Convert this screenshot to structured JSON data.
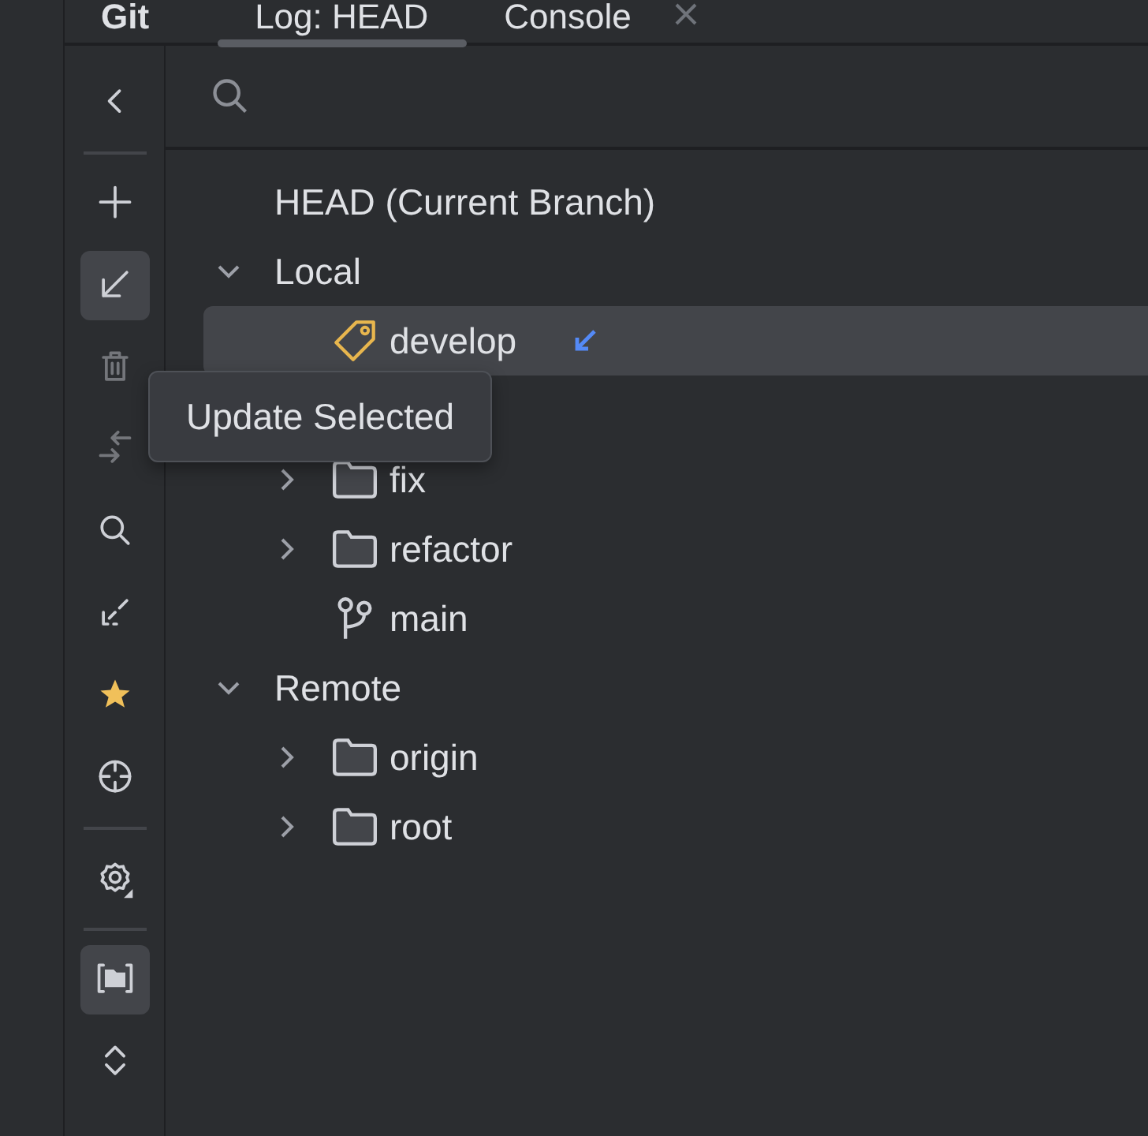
{
  "tool_window": {
    "title": "Git"
  },
  "tabs": [
    {
      "label": "Log: HEAD",
      "selected": true,
      "closable": false
    },
    {
      "label": "Console",
      "selected": false,
      "closable": true
    }
  ],
  "toolbar": [
    {
      "kind": "back",
      "selected": false,
      "disabled": false
    },
    {
      "kind": "separator"
    },
    {
      "kind": "add",
      "selected": false,
      "disabled": false
    },
    {
      "kind": "update",
      "selected": true,
      "disabled": false
    },
    {
      "kind": "delete",
      "selected": false,
      "disabled": true
    },
    {
      "kind": "compare",
      "selected": false,
      "disabled": true
    },
    {
      "kind": "search",
      "selected": false,
      "disabled": false
    },
    {
      "kind": "fetch",
      "selected": false,
      "disabled": false
    },
    {
      "kind": "favorite",
      "selected": false,
      "disabled": false
    },
    {
      "kind": "locate",
      "selected": false,
      "disabled": false
    },
    {
      "kind": "separator"
    },
    {
      "kind": "settings",
      "selected": false,
      "disabled": false
    },
    {
      "kind": "separator"
    },
    {
      "kind": "group",
      "selected": true,
      "disabled": false
    },
    {
      "kind": "expand",
      "selected": false,
      "disabled": false
    }
  ],
  "tree": [
    {
      "label": "HEAD (Current Branch)",
      "selected": false
    },
    {
      "label": "Local",
      "expanded": true,
      "selected": false,
      "children": [
        {
          "label": "develop",
          "kind": "tag",
          "selected": true,
          "incoming": true
        },
        {
          "label": "fix",
          "kind": "folder",
          "expanded": false,
          "selected": false,
          "incoming": false
        },
        {
          "label": "refactor",
          "kind": "folder",
          "expanded": false,
          "selected": false,
          "incoming": false
        },
        {
          "label": "main",
          "kind": "branch",
          "selected": false,
          "incoming": false
        }
      ]
    },
    {
      "label": "Remote",
      "expanded": true,
      "selected": false,
      "children": [
        {
          "label": "origin",
          "kind": "folder",
          "expanded": false,
          "selected": false,
          "incoming": false
        },
        {
          "label": "root",
          "kind": "folder",
          "expanded": false,
          "selected": false,
          "incoming": false
        }
      ]
    }
  ],
  "tooltip": {
    "text": "Update Selected"
  }
}
